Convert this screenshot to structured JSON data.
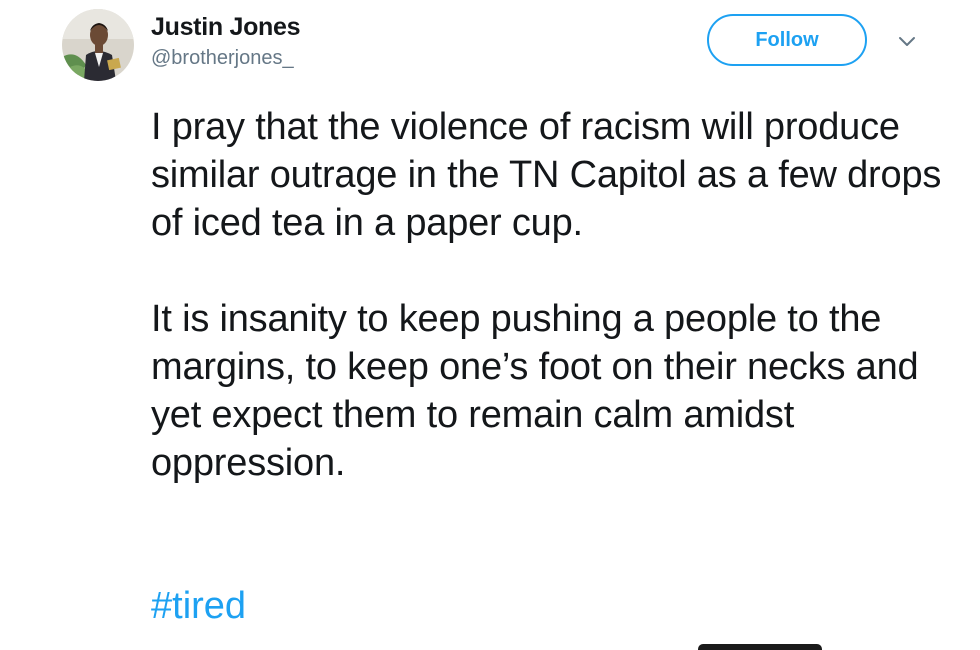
{
  "author": {
    "display_name": "Justin Jones",
    "handle": "@brotherjones_",
    "avatar_icon": "profile-photo"
  },
  "actions": {
    "follow_label": "Follow",
    "caret_icon": "chevron-down-icon"
  },
  "tweet": {
    "paragraph_1": "I pray that the violence of racism will produce similar outrage in the TN Capitol as a few drops of iced tea in a paper cup.",
    "paragraph_2": "It is insanity to keep pushing a people to the margins, to keep one’s foot on their necks and yet expect them to remain calm amidst oppression.",
    "hashtag": "#tired"
  },
  "colors": {
    "accent": "#1da1f2",
    "text_primary": "#14171a",
    "text_secondary": "#657786"
  }
}
